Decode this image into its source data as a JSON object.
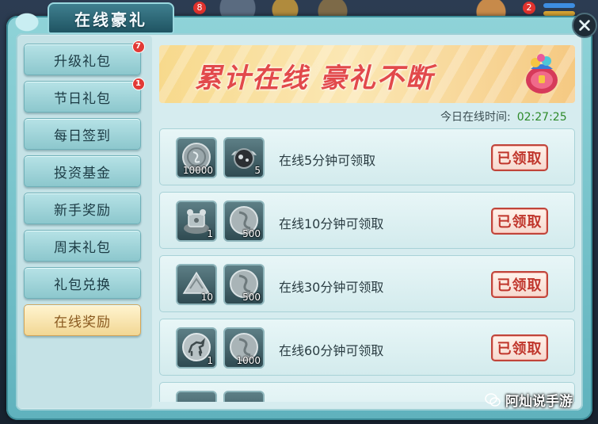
{
  "window": {
    "title": "在线豪礼"
  },
  "hud": {
    "badge_left": "8",
    "badge_right": "2"
  },
  "sidebar": {
    "items": [
      {
        "label": "升级礼包",
        "badge": "7"
      },
      {
        "label": "节日礼包",
        "badge": "1"
      },
      {
        "label": "每日签到",
        "badge": ""
      },
      {
        "label": "投资基金",
        "badge": ""
      },
      {
        "label": "新手奖励",
        "badge": ""
      },
      {
        "label": "周末礼包",
        "badge": ""
      },
      {
        "label": "礼包兑换",
        "badge": ""
      },
      {
        "label": "在线奖励",
        "badge": "",
        "active": true
      }
    ]
  },
  "banner": {
    "text": "累计在线 豪礼不断"
  },
  "online_time": {
    "label": "今日在线时间:",
    "value": "02:27:25"
  },
  "rewards": [
    {
      "label": "在线5分钟可领取",
      "button": "已领取",
      "items": [
        {
          "icon": "silver-coin-icon",
          "qty": "10000"
        },
        {
          "icon": "winged-orb-icon",
          "qty": "5"
        }
      ]
    },
    {
      "label": "在线10分钟可领取",
      "button": "已领取",
      "items": [
        {
          "icon": "treasure-pile-icon",
          "qty": "1"
        },
        {
          "icon": "silver-token-icon",
          "qty": "500"
        }
      ]
    },
    {
      "label": "在线30分钟可领取",
      "button": "已领取",
      "items": [
        {
          "icon": "silver-mound-icon",
          "qty": "10"
        },
        {
          "icon": "silver-token-icon",
          "qty": "500"
        }
      ]
    },
    {
      "label": "在线60分钟可领取",
      "button": "已领取",
      "items": [
        {
          "icon": "horse-medal-icon",
          "qty": "1"
        },
        {
          "icon": "silver-token-icon",
          "qty": "1000"
        }
      ]
    }
  ],
  "watermark": {
    "text": "阿灿说手游"
  },
  "colors": {
    "accent_red": "#c0362c",
    "time_green": "#2e8a2a",
    "active_tab": "#f2d794"
  }
}
